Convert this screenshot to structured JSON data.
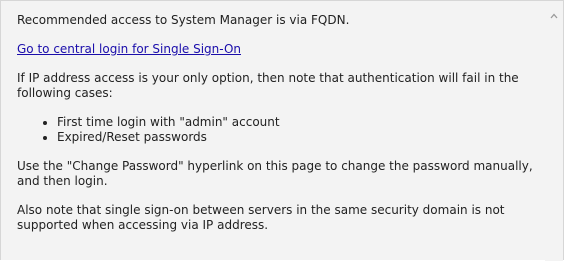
{
  "notice": {
    "intro": "Recommended access to System Manager is via FQDN.",
    "sso_link": "Go to central login for Single Sign-On",
    "ip_warning": "If IP address access is your only option, then note that authentication will fail in the following cases:",
    "cases": [
      "First time login with \"admin\" account",
      "Expired/Reset passwords"
    ],
    "change_password_note": "Use the \"Change Password\" hyperlink on this page to change the password manually, and then login.",
    "sso_note": "Also note that single sign-on between servers in the same security domain is not supported when accessing via IP address."
  },
  "icons": {
    "scroll_up": "chevron-up-icon"
  }
}
